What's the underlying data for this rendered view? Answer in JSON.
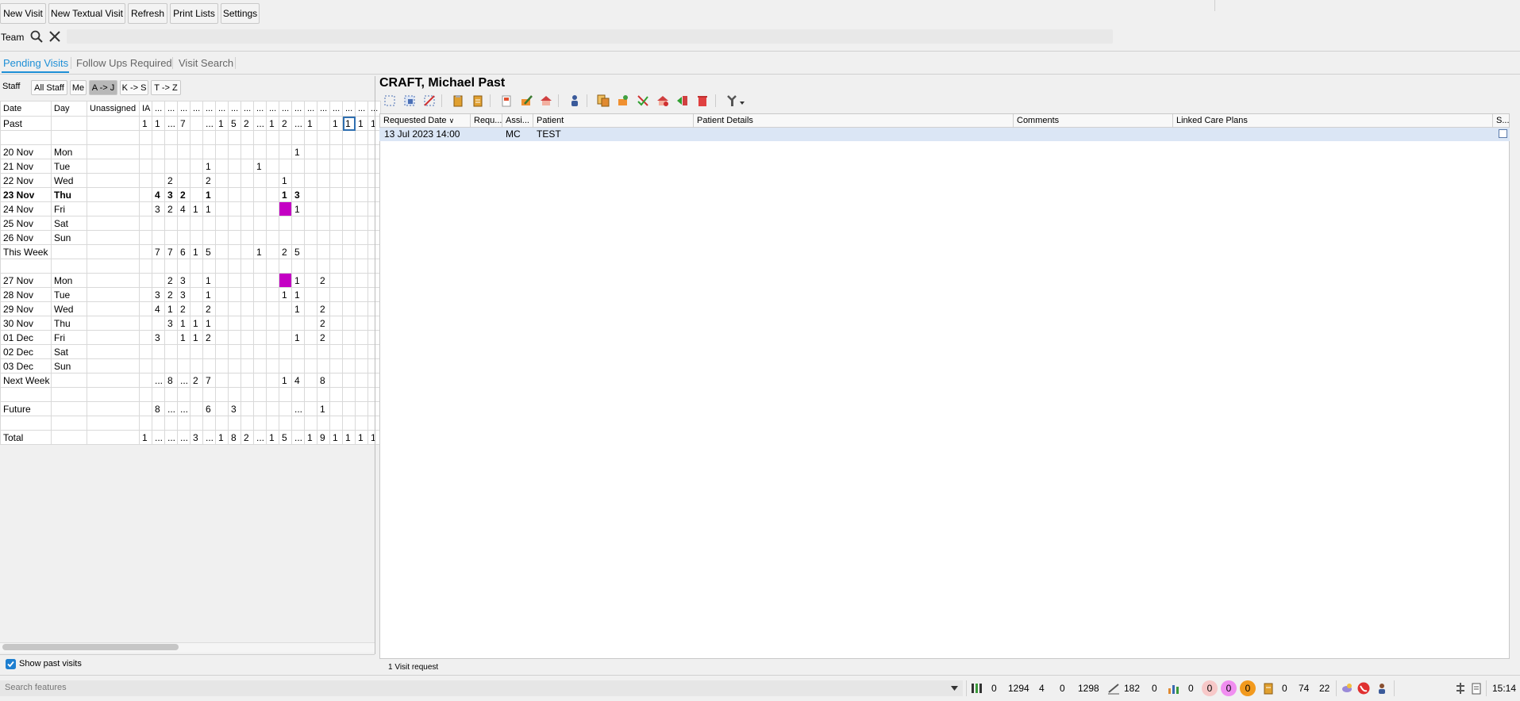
{
  "toolbar": {
    "new_visit": "New Visit",
    "new_textual_visit": "New Textual Visit",
    "refresh": "Refresh",
    "print_lists": "Print Lists",
    "settings": "Settings"
  },
  "team": {
    "label": "Team"
  },
  "tabs": [
    {
      "label": "Pending Visits"
    },
    {
      "label": "Follow Ups Required"
    },
    {
      "label": "Visit Search"
    }
  ],
  "staff_filter": {
    "label": "Staff",
    "options": [
      "All Staff",
      "Me",
      "A -> J",
      "K -> S",
      "T -> Z"
    ],
    "selected": "A -> J"
  },
  "grid": {
    "headers": [
      "Date",
      "Day",
      "Unassigned",
      "IA",
      "...",
      "...",
      "...",
      "...",
      "...",
      "...",
      "...",
      "...",
      "...",
      "...",
      "...",
      "...",
      "...",
      "...",
      "...",
      "..."
    ],
    "rows": [
      {
        "date": "Past",
        "day": "",
        "u": "",
        "c": [
          "1",
          "1",
          "...",
          "7",
          "",
          "...",
          "1",
          "5",
          "2",
          "...",
          "1",
          "2",
          "...",
          "1",
          "",
          "1",
          "1",
          "1",
          "1"
        ]
      },
      {
        "date": "",
        "day": "",
        "u": "",
        "c": [
          "",
          "",
          "",
          "",
          "",
          "",
          "",
          "",
          "",
          "",
          "",
          "",
          "",
          "",
          "",
          "",
          "",
          "",
          ""
        ]
      },
      {
        "date": "20 Nov",
        "day": "Mon",
        "u": "",
        "c": [
          "",
          "",
          "",
          "",
          "",
          "",
          "",
          "",
          "",
          "",
          "",
          "",
          "1",
          "",
          "",
          "",
          "",
          "",
          ""
        ]
      },
      {
        "date": "21 Nov",
        "day": "Tue",
        "u": "",
        "c": [
          "",
          "",
          "",
          "",
          "",
          "1",
          "",
          "",
          "",
          "1",
          "",
          "",
          "",
          "",
          "",
          "",
          "",
          "",
          ""
        ]
      },
      {
        "date": "22 Nov",
        "day": "Wed",
        "u": "",
        "c": [
          "",
          "",
          "2",
          "",
          "",
          "2",
          "",
          "",
          "",
          "",
          "",
          "1",
          "",
          "",
          "",
          "",
          "",
          "",
          ""
        ]
      },
      {
        "date": "23 Nov",
        "day": "Thu",
        "u": "",
        "bold": true,
        "c": [
          "",
          "4",
          "3",
          "2",
          "",
          "1",
          "",
          "",
          "",
          "",
          "",
          "1",
          "3",
          "",
          "",
          "",
          "",
          "",
          ""
        ]
      },
      {
        "date": "24 Nov",
        "day": "Fri",
        "u": "",
        "c": [
          "",
          "3",
          "2",
          "4",
          "1",
          "1",
          "",
          "",
          "",
          "",
          "",
          "",
          "1",
          "",
          "",
          "",
          "",
          "",
          ""
        ]
      },
      {
        "date": "25 Nov",
        "day": "Sat",
        "u": "",
        "c": [
          "",
          "",
          "",
          "",
          "",
          "",
          "",
          "",
          "",
          "",
          "",
          "",
          "",
          "",
          "",
          "",
          "",
          "",
          ""
        ]
      },
      {
        "date": "26 Nov",
        "day": "Sun",
        "u": "",
        "c": [
          "",
          "",
          "",
          "",
          "",
          "",
          "",
          "",
          "",
          "",
          "",
          "",
          "",
          "",
          "",
          "",
          "",
          "",
          ""
        ]
      },
      {
        "date": "This Week",
        "day": "",
        "u": "",
        "c": [
          "",
          "7",
          "7",
          "6",
          "1",
          "5",
          "",
          "",
          "",
          "1",
          "",
          "2",
          "5",
          "",
          "",
          "",
          "",
          "",
          ""
        ]
      },
      {
        "date": "",
        "day": "",
        "u": "",
        "c": [
          "",
          "",
          "",
          "",
          "",
          "",
          "",
          "",
          "",
          "",
          "",
          "",
          "",
          "",
          "",
          "",
          "",
          "",
          ""
        ]
      },
      {
        "date": "27 Nov",
        "day": "Mon",
        "u": "",
        "c": [
          "",
          "",
          "2",
          "3",
          "",
          "1",
          "",
          "",
          "",
          "",
          "",
          "",
          "1",
          "",
          "2",
          "",
          "",
          "",
          ""
        ]
      },
      {
        "date": "28 Nov",
        "day": "Tue",
        "u": "",
        "c": [
          "",
          "3",
          "2",
          "3",
          "",
          "1",
          "",
          "",
          "",
          "",
          "",
          "1",
          "1",
          "",
          "",
          "",
          "",
          "",
          ""
        ]
      },
      {
        "date": "29 Nov",
        "day": "Wed",
        "u": "",
        "c": [
          "",
          "4",
          "1",
          "2",
          "",
          "2",
          "",
          "",
          "",
          "",
          "",
          "",
          "1",
          "",
          "2",
          "",
          "",
          "",
          ""
        ]
      },
      {
        "date": "30 Nov",
        "day": "Thu",
        "u": "",
        "c": [
          "",
          "",
          "3",
          "1",
          "1",
          "1",
          "",
          "",
          "",
          "",
          "",
          "",
          "",
          "",
          "2",
          "",
          "",
          "",
          ""
        ]
      },
      {
        "date": "01 Dec",
        "day": "Fri",
        "u": "",
        "c": [
          "",
          "3",
          "",
          "1",
          "1",
          "2",
          "",
          "",
          "",
          "",
          "",
          "",
          "1",
          "",
          "2",
          "",
          "",
          "",
          ""
        ]
      },
      {
        "date": "02 Dec",
        "day": "Sat",
        "u": "",
        "c": [
          "",
          "",
          "",
          "",
          "",
          "",
          "",
          "",
          "",
          "",
          "",
          "",
          "",
          "",
          "",
          "",
          "",
          "",
          ""
        ]
      },
      {
        "date": "03 Dec",
        "day": "Sun",
        "u": "",
        "c": [
          "",
          "",
          "",
          "",
          "",
          "",
          "",
          "",
          "",
          "",
          "",
          "",
          "",
          "",
          "",
          "",
          "",
          "",
          ""
        ]
      },
      {
        "date": "Next Week",
        "day": "",
        "u": "",
        "c": [
          "",
          "...",
          "8",
          "...",
          "2",
          "7",
          "",
          "",
          "",
          "",
          "",
          "1",
          "4",
          "",
          "8",
          "",
          "",
          "",
          ""
        ]
      },
      {
        "date": "",
        "day": "",
        "u": "",
        "c": [
          "",
          "",
          "",
          "",
          "",
          "",
          "",
          "",
          "",
          "",
          "",
          "",
          "",
          "",
          "",
          "",
          "",
          "",
          ""
        ]
      },
      {
        "date": "Future",
        "day": "",
        "u": "",
        "c": [
          "",
          "8",
          "...",
          "...",
          "",
          "6",
          "",
          "3",
          "",
          "",
          "",
          "",
          "...",
          "",
          "1",
          "",
          "",
          "",
          ""
        ]
      },
      {
        "date": "",
        "day": "",
        "u": "",
        "c": [
          "",
          "",
          "",
          "",
          "",
          "",
          "",
          "",
          "",
          "",
          "",
          "",
          "",
          "",
          "",
          "",
          "",
          "",
          ""
        ]
      },
      {
        "date": "Total",
        "day": "",
        "u": "",
        "c": [
          "1",
          "...",
          "...",
          "...",
          "3",
          "...",
          "1",
          "8",
          "2",
          "...",
          "1",
          "5",
          "...",
          "1",
          "9",
          "1",
          "1",
          "1",
          "1"
        ]
      }
    ]
  },
  "show_past": {
    "label": "Show past visits",
    "checked": true
  },
  "patient": {
    "name": "CRAFT, Michael Past"
  },
  "list": {
    "headers": [
      "Requested Date",
      "Requ...",
      "Assi...",
      "Patient",
      "Patient Details",
      "Comments",
      "Linked Care Plans",
      "S..."
    ],
    "rows": [
      {
        "date": "13 Jul 2023 14:00",
        "req": "",
        "assigned": "MC",
        "patient": "TEST",
        "details": "",
        "comments": "",
        "plans": ""
      }
    ],
    "status": "1 Visit request"
  },
  "statusbar": {
    "search_placeholder": "Search features",
    "n1": "0",
    "n2": "1294",
    "n3": "4",
    "n4": "0",
    "n5": "1298",
    "n6": "182",
    "n7": "0",
    "n8": "0",
    "c1": "0",
    "c2": "0",
    "c3": "0",
    "n9": "0",
    "n10": "74",
    "n11": "22",
    "time": "15:14"
  },
  "colors": {
    "accent": "#1e8fd6",
    "highlight": "#c400c4",
    "row_selected": "#dbe6f5"
  }
}
